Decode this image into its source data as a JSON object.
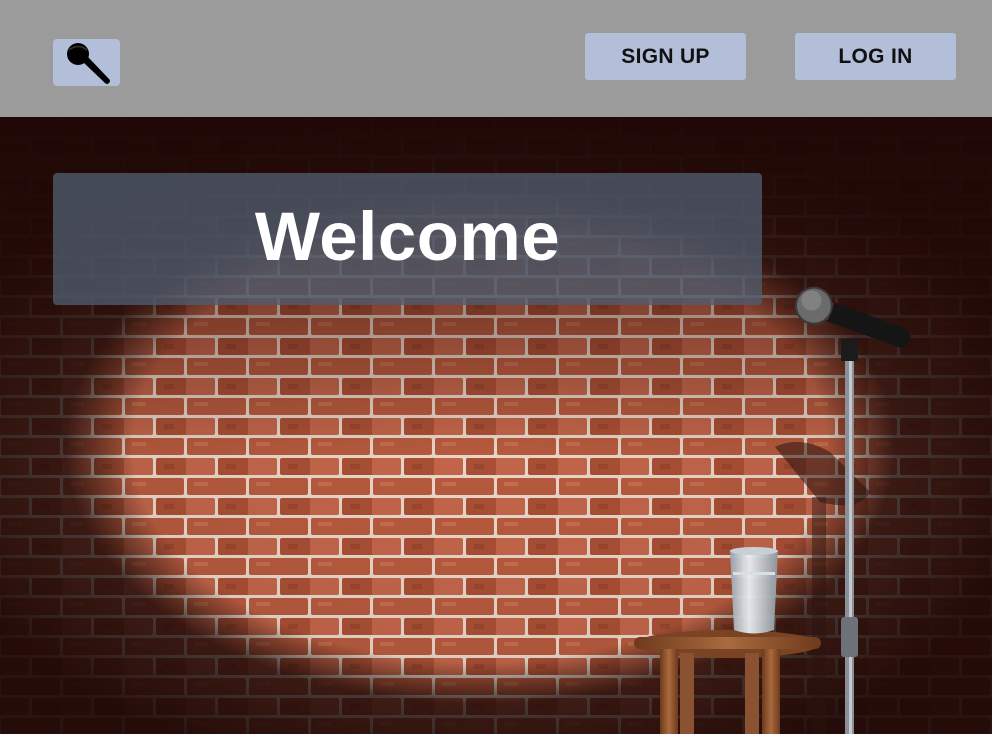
{
  "header": {
    "logo_icon": "microphone-icon",
    "signup_label": "SIGN UP",
    "login_label": "LOG IN",
    "colors": {
      "bar": "#9b9b9b",
      "button": "#b3bfd9",
      "text": "#111111"
    }
  },
  "hero": {
    "title": "Welcome",
    "scene": [
      "brick-wall",
      "spotlight",
      "microphone-stand",
      "stool",
      "water-glass"
    ],
    "colors": {
      "panel": "#505c6e",
      "title": "#ffffff",
      "brick": "#b2553a"
    }
  }
}
